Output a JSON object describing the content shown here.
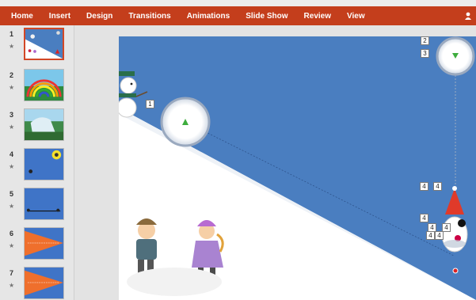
{
  "ribbon": {
    "tabs": [
      "Home",
      "Insert",
      "Design",
      "Transitions",
      "Animations",
      "Slide Show",
      "Review",
      "View"
    ]
  },
  "thumbnails": [
    {
      "number": "1",
      "selected": true,
      "theme": "snow-triangle"
    },
    {
      "number": "2",
      "selected": false,
      "theme": "rainbow"
    },
    {
      "number": "3",
      "selected": false,
      "theme": "waterfall"
    },
    {
      "number": "4",
      "selected": false,
      "theme": "blue-moon"
    },
    {
      "number": "5",
      "selected": false,
      "theme": "blue-line"
    },
    {
      "number": "6",
      "selected": false,
      "theme": "orange-triangle"
    },
    {
      "number": "7",
      "selected": false,
      "theme": "orange-triangle"
    }
  ],
  "animation_badges": {
    "snowman_path": "1",
    "top_right_a": "2",
    "top_right_b": "3",
    "hat_a": "4",
    "hat_b": "4",
    "mid": "4",
    "low_a": "4",
    "low_b": "4",
    "low_c": "4",
    "low_d": "4"
  },
  "colors": {
    "ribbon": "#c43e1c",
    "slide_blue": "#4a7ec0",
    "selection": "#d24726",
    "gnome_hat": "#e03a2a"
  }
}
